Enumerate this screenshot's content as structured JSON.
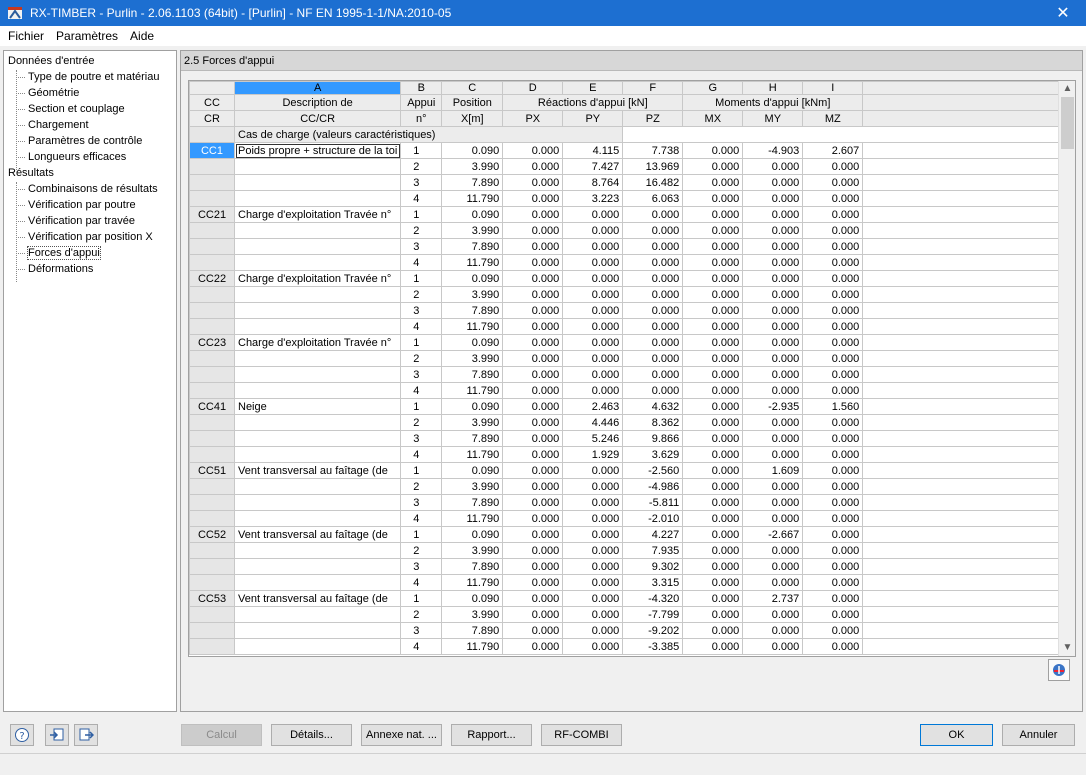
{
  "window": {
    "title": "RX-TIMBER - Purlin - 2.06.1103 (64bit) - [Purlin] - NF EN 1995-1-1/NA:2010-05"
  },
  "menu": [
    "Fichier",
    "Paramètres",
    "Aide"
  ],
  "nav": {
    "groups": [
      {
        "label": "Données d'entrée",
        "items": [
          "Type de poutre et matériau",
          "Géométrie",
          "Section et couplage",
          "Chargement",
          "Paramètres de contrôle",
          "Longueurs efficaces"
        ]
      },
      {
        "label": "Résultats",
        "items": [
          "Combinaisons de résultats",
          "Vérification par poutre",
          "Vérification par travée",
          "Vérification par position X",
          "Forces d'appui",
          "Déformations"
        ]
      }
    ],
    "selected": "Forces d'appui"
  },
  "panel": {
    "title": "2.5 Forces d'appui"
  },
  "table": {
    "col_letters": [
      "A",
      "B",
      "C",
      "D",
      "E",
      "F",
      "G",
      "H",
      "I"
    ],
    "header": {
      "cc_top": "CC",
      "cc_bottom": "CR",
      "desc_top": "Description de",
      "desc_bottom": "CC/CR",
      "appui_top": "Appui",
      "appui_bottom": "n°",
      "pos_top": "Position",
      "pos_bottom": "X[m]",
      "reactions": "Réactions d'appui [kN]",
      "moments": "Moments d'appui [kNm]",
      "px": "PX",
      "py": "PY",
      "pz": "PZ",
      "mx": "MX",
      "my": "MY",
      "mz": "MZ"
    },
    "section_label": "Cas de charge (valeurs caractéristiques)",
    "groups": [
      {
        "cc": "CC1",
        "desc": "Poids propre + structure de la toi",
        "rows": [
          [
            "1",
            "0.090",
            "0.000",
            "4.115",
            "7.738",
            "0.000",
            "-4.903",
            "2.607"
          ],
          [
            "2",
            "3.990",
            "0.000",
            "7.427",
            "13.969",
            "0.000",
            "0.000",
            "0.000"
          ],
          [
            "3",
            "7.890",
            "0.000",
            "8.764",
            "16.482",
            "0.000",
            "0.000",
            "0.000"
          ],
          [
            "4",
            "11.790",
            "0.000",
            "3.223",
            "6.063",
            "0.000",
            "0.000",
            "0.000"
          ]
        ]
      },
      {
        "cc": "CC21",
        "desc": "Charge d'exploitation Travée n°",
        "rows": [
          [
            "1",
            "0.090",
            "0.000",
            "0.000",
            "0.000",
            "0.000",
            "0.000",
            "0.000"
          ],
          [
            "2",
            "3.990",
            "0.000",
            "0.000",
            "0.000",
            "0.000",
            "0.000",
            "0.000"
          ],
          [
            "3",
            "7.890",
            "0.000",
            "0.000",
            "0.000",
            "0.000",
            "0.000",
            "0.000"
          ],
          [
            "4",
            "11.790",
            "0.000",
            "0.000",
            "0.000",
            "0.000",
            "0.000",
            "0.000"
          ]
        ]
      },
      {
        "cc": "CC22",
        "desc": "Charge d'exploitation Travée n°",
        "rows": [
          [
            "1",
            "0.090",
            "0.000",
            "0.000",
            "0.000",
            "0.000",
            "0.000",
            "0.000"
          ],
          [
            "2",
            "3.990",
            "0.000",
            "0.000",
            "0.000",
            "0.000",
            "0.000",
            "0.000"
          ],
          [
            "3",
            "7.890",
            "0.000",
            "0.000",
            "0.000",
            "0.000",
            "0.000",
            "0.000"
          ],
          [
            "4",
            "11.790",
            "0.000",
            "0.000",
            "0.000",
            "0.000",
            "0.000",
            "0.000"
          ]
        ]
      },
      {
        "cc": "CC23",
        "desc": "Charge d'exploitation Travée n°",
        "rows": [
          [
            "1",
            "0.090",
            "0.000",
            "0.000",
            "0.000",
            "0.000",
            "0.000",
            "0.000"
          ],
          [
            "2",
            "3.990",
            "0.000",
            "0.000",
            "0.000",
            "0.000",
            "0.000",
            "0.000"
          ],
          [
            "3",
            "7.890",
            "0.000",
            "0.000",
            "0.000",
            "0.000",
            "0.000",
            "0.000"
          ],
          [
            "4",
            "11.790",
            "0.000",
            "0.000",
            "0.000",
            "0.000",
            "0.000",
            "0.000"
          ]
        ]
      },
      {
        "cc": "CC41",
        "desc": "Neige",
        "rows": [
          [
            "1",
            "0.090",
            "0.000",
            "2.463",
            "4.632",
            "0.000",
            "-2.935",
            "1.560"
          ],
          [
            "2",
            "3.990",
            "0.000",
            "4.446",
            "8.362",
            "0.000",
            "0.000",
            "0.000"
          ],
          [
            "3",
            "7.890",
            "0.000",
            "5.246",
            "9.866",
            "0.000",
            "0.000",
            "0.000"
          ],
          [
            "4",
            "11.790",
            "0.000",
            "1.929",
            "3.629",
            "0.000",
            "0.000",
            "0.000"
          ]
        ]
      },
      {
        "cc": "CC51",
        "desc": "Vent transversal au faîtage (de",
        "rows": [
          [
            "1",
            "0.090",
            "0.000",
            "0.000",
            "-2.560",
            "0.000",
            "1.609",
            "0.000"
          ],
          [
            "2",
            "3.990",
            "0.000",
            "0.000",
            "-4.986",
            "0.000",
            "0.000",
            "0.000"
          ],
          [
            "3",
            "7.890",
            "0.000",
            "0.000",
            "-5.811",
            "0.000",
            "0.000",
            "0.000"
          ],
          [
            "4",
            "11.790",
            "0.000",
            "0.000",
            "-2.010",
            "0.000",
            "0.000",
            "0.000"
          ]
        ]
      },
      {
        "cc": "CC52",
        "desc": "Vent transversal au faîtage (de",
        "rows": [
          [
            "1",
            "0.090",
            "0.000",
            "0.000",
            "4.227",
            "0.000",
            "-2.667",
            "0.000"
          ],
          [
            "2",
            "3.990",
            "0.000",
            "0.000",
            "7.935",
            "0.000",
            "0.000",
            "0.000"
          ],
          [
            "3",
            "7.890",
            "0.000",
            "0.000",
            "9.302",
            "0.000",
            "0.000",
            "0.000"
          ],
          [
            "4",
            "11.790",
            "0.000",
            "0.000",
            "3.315",
            "0.000",
            "0.000",
            "0.000"
          ]
        ]
      },
      {
        "cc": "CC53",
        "desc": "Vent transversal au faîtage (de",
        "rows": [
          [
            "1",
            "0.090",
            "0.000",
            "0.000",
            "-4.320",
            "0.000",
            "2.737",
            "0.000"
          ],
          [
            "2",
            "3.990",
            "0.000",
            "0.000",
            "-7.799",
            "0.000",
            "0.000",
            "0.000"
          ],
          [
            "3",
            "7.890",
            "0.000",
            "0.000",
            "-9.202",
            "0.000",
            "0.000",
            "0.000"
          ],
          [
            "4",
            "11.790",
            "0.000",
            "0.000",
            "-3.385",
            "0.000",
            "0.000",
            "0.000"
          ]
        ]
      }
    ]
  },
  "buttons": {
    "calcul": "Calcul",
    "details": "Détails...",
    "annexe": "Annexe nat. ...",
    "rapport": "Rapport...",
    "rfcombi": "RF-COMBI",
    "ok": "OK",
    "annuler": "Annuler"
  },
  "colors": {
    "titlebar": "#1d6fd1",
    "selection": "#3399ff"
  }
}
